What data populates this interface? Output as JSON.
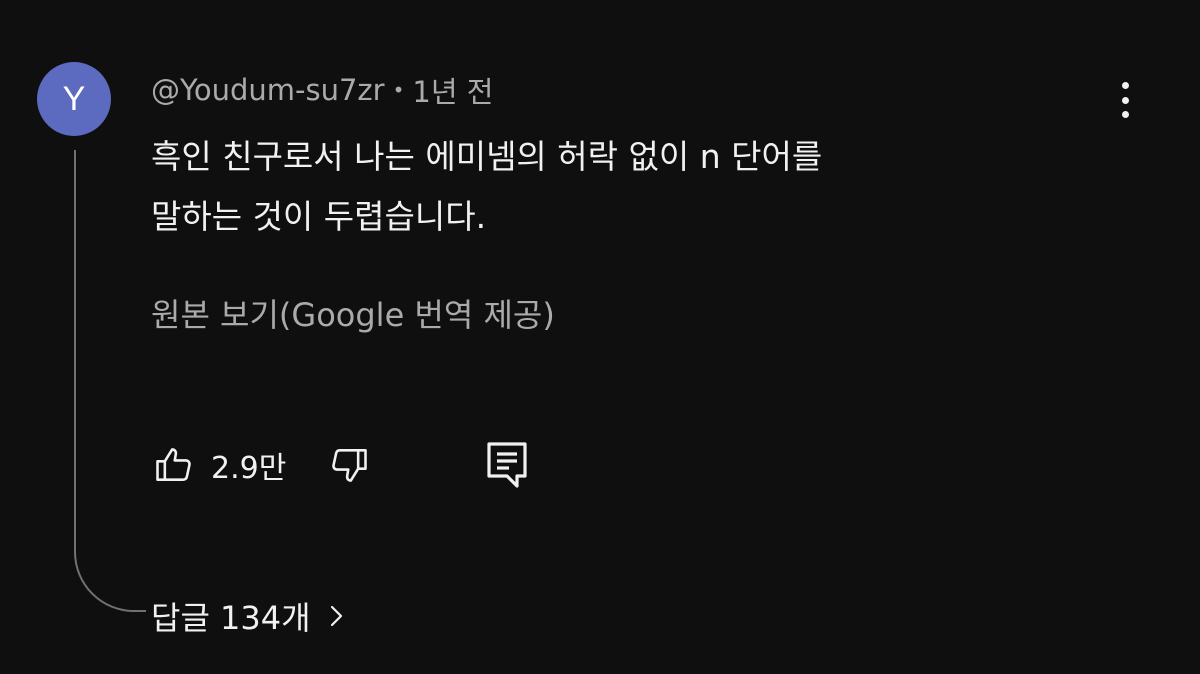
{
  "comment": {
    "avatar_letter": "Y",
    "avatar_color": "#5c6bc0",
    "author": "@Youdum-su7zr",
    "separator": "•",
    "time": "1년 전",
    "text_lines": [
      "흑인 친구로서 나는 에미넴의 허락 없이 n 단어를",
      "말하는 것이 두렵습니다."
    ],
    "see_original": "원본 보기(Google 번역 제공)",
    "like_count": "2.9만",
    "replies_label": "답글 134개"
  },
  "icons": {
    "menu": "more-vert-icon",
    "like": "thumbs-up-icon",
    "dislike": "thumbs-down-icon",
    "reply": "comment-icon",
    "replies": "chevron-right-icon"
  },
  "colors": {
    "background": "#0f0f0f",
    "primary_text": "#f1f1f1",
    "secondary_text": "#aaaaaa",
    "thread_line": "#717171"
  }
}
